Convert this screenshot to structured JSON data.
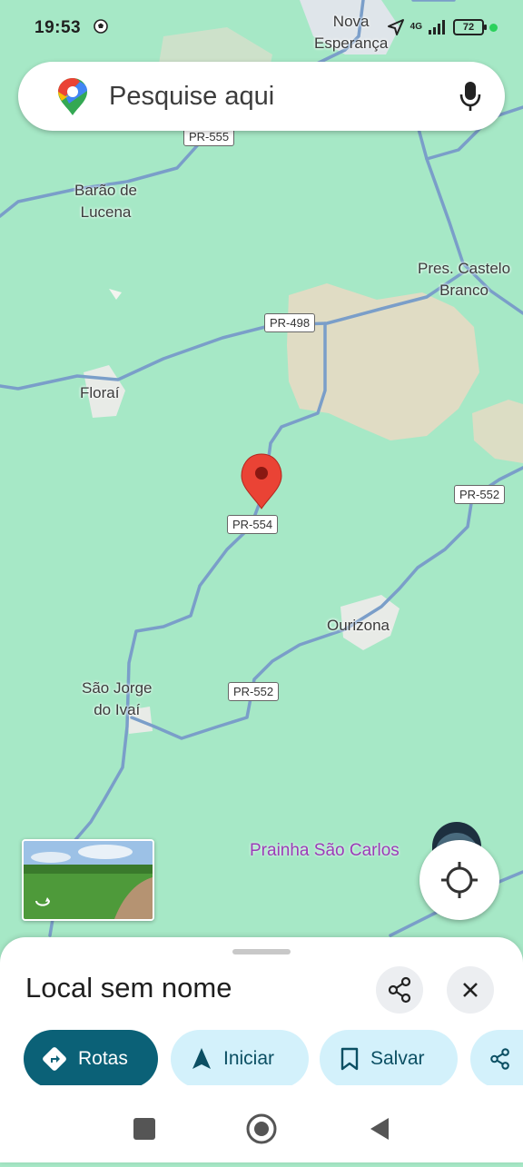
{
  "status_bar": {
    "time": "19:53",
    "network": "4G",
    "battery": "72"
  },
  "search": {
    "placeholder": "Pesquise aqui"
  },
  "map": {
    "places": [
      {
        "label": "Nova\nEsperança"
      },
      {
        "label": "Barão de\nLucena"
      },
      {
        "label": "Pres. Castelo\nBranco"
      },
      {
        "label": "Floraí"
      },
      {
        "label": "Ourizona"
      },
      {
        "label": "São Jorge\ndo Ivaí"
      }
    ],
    "road_shields": [
      "PR-555",
      "PR-498",
      "PR-552",
      "PR-554",
      "PR-552"
    ],
    "poi": "Prainha São Carlos"
  },
  "place_sheet": {
    "title": "Local sem nome",
    "actions": [
      "Rotas",
      "Iniciar",
      "Salvar"
    ]
  },
  "colors": {
    "map_background": "#a6e8c6",
    "road": "#7a9ec9",
    "marker": "#ea4335",
    "primary_button": "#0b6177",
    "chip_background": "#d3f1fb",
    "poi_text": "#9b3bb8"
  }
}
